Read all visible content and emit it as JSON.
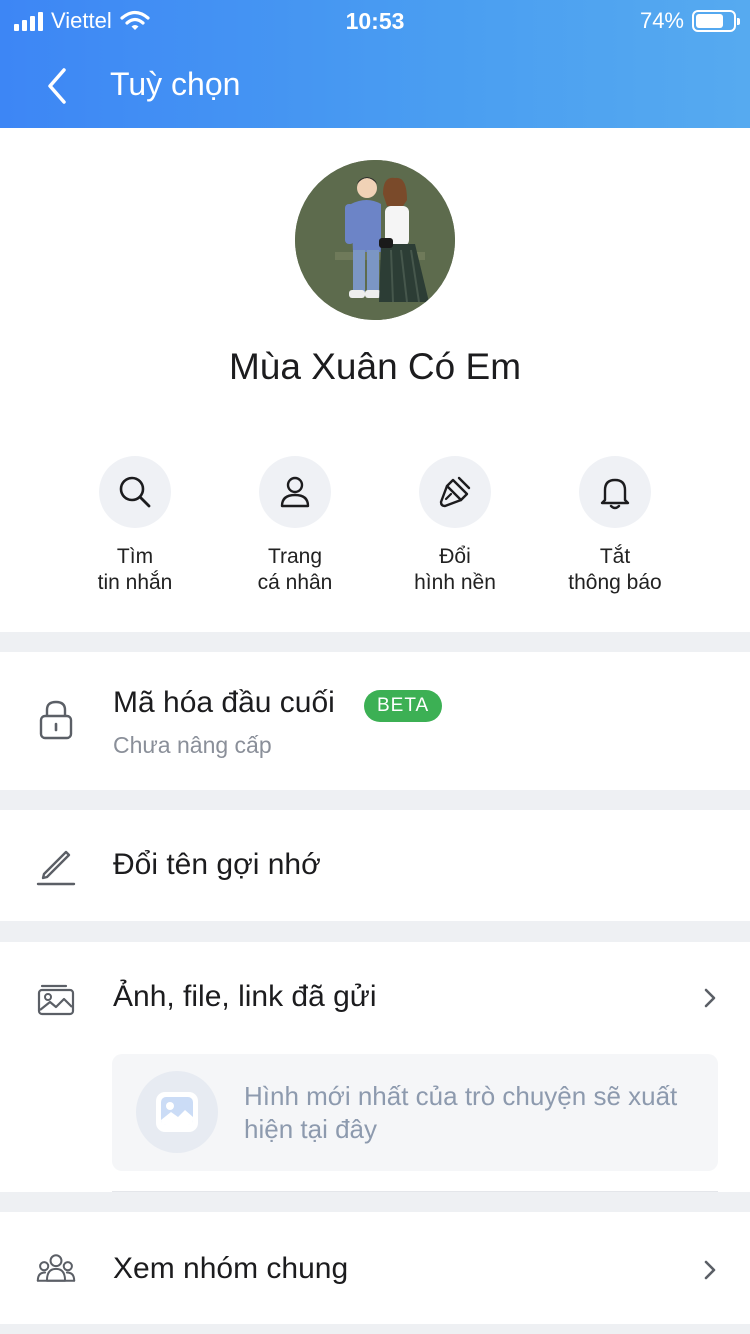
{
  "status_bar": {
    "carrier": "Viettel",
    "time": "10:53",
    "battery": "74%",
    "battery_level": 0.74
  },
  "nav": {
    "title": "Tuỳ chọn",
    "back_icon": "chevron-left-icon"
  },
  "profile": {
    "name": "Mùa Xuân Có Em"
  },
  "actions": [
    {
      "label": "Tìm\ntin nhắn",
      "icon": "search-icon"
    },
    {
      "label": "Trang\ncá nhân",
      "icon": "person-icon"
    },
    {
      "label": "Đổi\nhình nền",
      "icon": "paint-brush-icon"
    },
    {
      "label": "Tắt\nthông báo",
      "icon": "bell-icon"
    }
  ],
  "encryption": {
    "title": "Mã hóa đầu cuối",
    "badge": "BETA",
    "subtitle": "Chưa nâng cấp",
    "icon": "lock-icon"
  },
  "rename": {
    "title": "Đổi tên gợi nhớ",
    "icon": "pencil-icon"
  },
  "media": {
    "title": "Ảnh, file, link đã gửi",
    "placeholder": "Hình mới nhất của trò chuyện sẽ xuất hiện tại đây",
    "icon": "gallery-icon"
  },
  "groups": {
    "title": "Xem nhóm chung",
    "icon": "group-icon"
  },
  "colors": {
    "header_start": "#3d86f5",
    "header_end": "#56aaf0",
    "beta_badge": "#3cb054",
    "avatar_bg": "#5d6b4d"
  }
}
